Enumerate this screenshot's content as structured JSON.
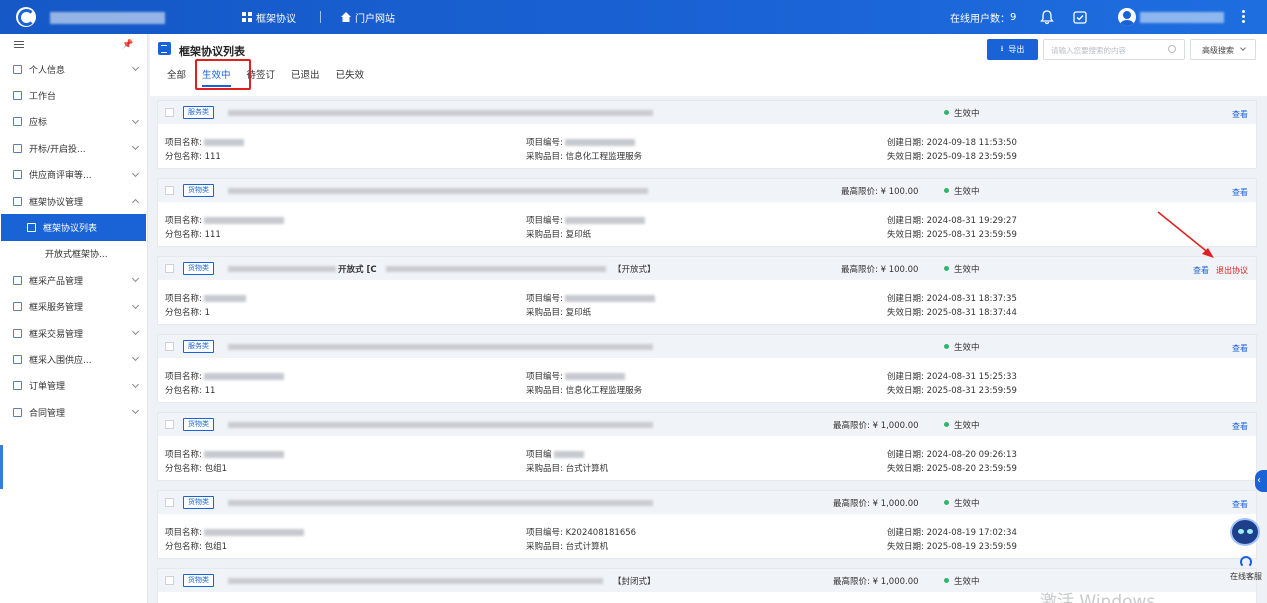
{
  "topbar": {
    "nav_framework": "框架协议",
    "nav_portal": "门户网站",
    "online_label": "在线用户数：",
    "online_count": "9"
  },
  "sidebar": {
    "items": [
      {
        "label": "个人信息",
        "expandable": true
      },
      {
        "label": "工作台",
        "expandable": false
      },
      {
        "label": "应标",
        "expandable": true
      },
      {
        "label": "开标/开启投...",
        "expandable": true
      },
      {
        "label": "供应商评审等...",
        "expandable": true
      },
      {
        "label": "框架协议管理",
        "expandable": true,
        "expanded": true
      },
      {
        "label": "框架协议列表",
        "active": true,
        "sub": true
      },
      {
        "label": "开放式框架协...",
        "sub": true
      },
      {
        "label": "框采产品管理",
        "expandable": true
      },
      {
        "label": "框采服务管理",
        "expandable": true
      },
      {
        "label": "框采交易管理",
        "expandable": true
      },
      {
        "label": "框采入围供应...",
        "expandable": true
      },
      {
        "label": "订单管理",
        "expandable": true
      },
      {
        "label": "合同管理",
        "expandable": true
      }
    ]
  },
  "page": {
    "title": "框架协议列表",
    "export_label": "导出",
    "search_placeholder": "请输入您要搜索的内容",
    "advanced_search": "高级搜索",
    "tabs": [
      "全部",
      "生效中",
      "待签订",
      "已退出",
      "已失效"
    ],
    "active_tab": 1
  },
  "labels": {
    "project_name": "项目名称:",
    "subpackage_name": "分包名称:",
    "project_no": "项目编号:",
    "project_no_alt": "项目编",
    "category": "采购品目:",
    "create_date": "创建日期:",
    "expire_date": "失效日期:",
    "max_price": "最高限价:",
    "view": "查看",
    "exit": "退出协议"
  },
  "cards": [
    {
      "tag": "服务类",
      "title_suffix": "",
      "price": "",
      "status": "生效中",
      "subpackage": "111",
      "project_no": "",
      "category": "信息化工程监理服务",
      "created": "2024-09-18 11:53:50",
      "expires": "2025-09-18 23:59:59",
      "exit": false
    },
    {
      "tag": "货物类",
      "title_suffix": "",
      "price": "¥ 100.00",
      "status": "生效中",
      "subpackage": "111",
      "project_no": "",
      "category": "复印纸",
      "created": "2024-08-31 19:29:27",
      "expires": "2025-08-31 23:59:59",
      "exit": false
    },
    {
      "tag": "货物类",
      "title_prefix": "开放式 [C",
      "title_suffix": "【开放式】",
      "price": "¥ 100.00",
      "status": "生效中",
      "subpackage": "1",
      "project_no": "",
      "category": "复印纸",
      "created": "2024-08-31 18:37:35",
      "expires": "2025-08-31 18:37:44",
      "exit": true
    },
    {
      "tag": "服务类",
      "title_suffix": "",
      "price": "",
      "status": "生效中",
      "subpackage": "11",
      "project_no": "",
      "category": "信息化工程监理服务",
      "created": "2024-08-31 15:25:33",
      "expires": "2025-08-31 23:59:59",
      "exit": false
    },
    {
      "tag": "货物类",
      "title_suffix": "",
      "price": "¥ 1,000.00",
      "status": "生效中",
      "subpackage": "包组1",
      "project_no": "",
      "category": "台式计算机",
      "created": "2024-08-20 09:26:13",
      "expires": "2025-08-20 23:59:59",
      "exit": false
    },
    {
      "tag": "货物类",
      "title_suffix": "",
      "price": "¥ 1,000.00",
      "status": "生效中",
      "subpackage": "包组1",
      "project_no": "K202408181656",
      "category": "台式计算机",
      "created": "2024-08-19 17:02:34",
      "expires": "2025-08-19 23:59:59",
      "exit": false
    },
    {
      "tag": "货物类",
      "title_suffix": "【封闭式】",
      "price": "¥ 1,000.00",
      "status": "生效中"
    }
  ],
  "widgets": {
    "online_service": "在线客服",
    "watermark": "激活 Windows"
  }
}
